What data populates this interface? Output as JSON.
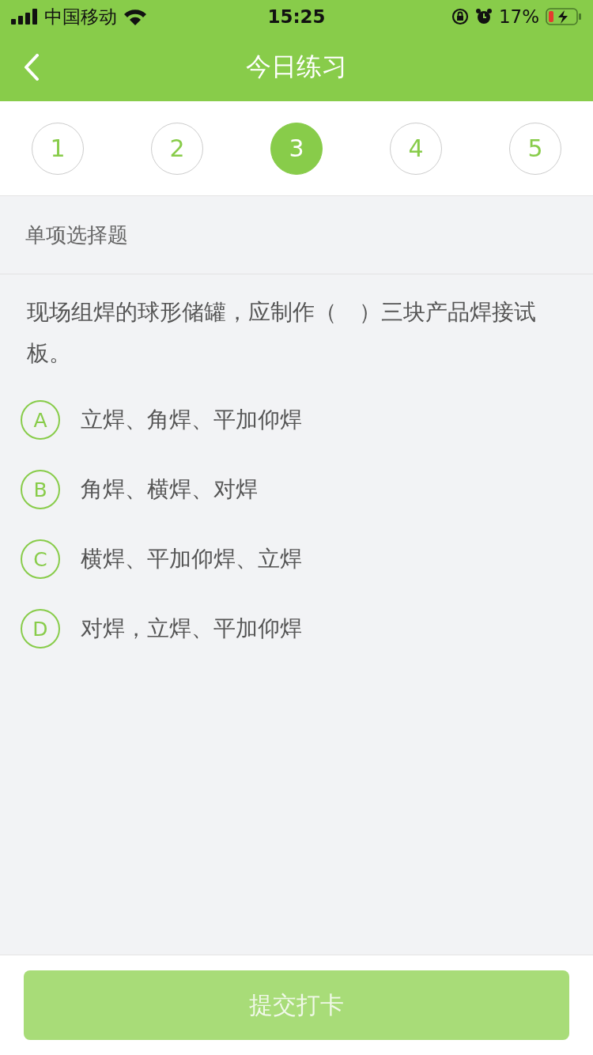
{
  "status_bar": {
    "carrier": "中国移动",
    "time": "15:25",
    "battery_percent": "17%"
  },
  "nav": {
    "title": "今日练习"
  },
  "steps": [
    {
      "label": "1",
      "selected": false
    },
    {
      "label": "2",
      "selected": false
    },
    {
      "label": "3",
      "selected": true
    },
    {
      "label": "4",
      "selected": false
    },
    {
      "label": "5",
      "selected": false
    }
  ],
  "section": {
    "title": "单项选择题"
  },
  "question": {
    "text": "现场组焊的球形储罐，应制作（　）三块产品焊接试板。"
  },
  "options": [
    {
      "letter": "A",
      "text": "立焊、角焊、平加仰焊",
      "selected": false
    },
    {
      "letter": "B",
      "text": "角焊、横焊、对焊",
      "selected": false
    },
    {
      "letter": "C",
      "text": "横焊、平加仰焊、立焊",
      "selected": false
    },
    {
      "letter": "D",
      "text": "对焊，立焊、平加仰焊",
      "selected": false
    }
  ],
  "submit": {
    "label": "提交打卡",
    "disabled": true
  }
}
